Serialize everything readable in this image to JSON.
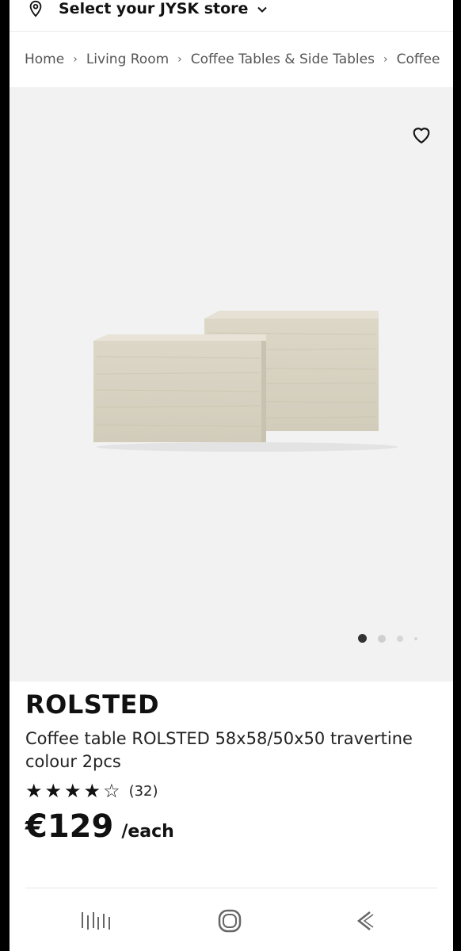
{
  "store_bar": {
    "label": "Select your JYSK store",
    "icons": {
      "location": "location-pin-icon",
      "dropdown": "chevron-down-icon"
    }
  },
  "breadcrumb": {
    "items": [
      "Home",
      "Living Room",
      "Coffee Tables & Side Tables",
      "Coffee"
    ],
    "separator": "›"
  },
  "gallery": {
    "favorite_icon": "heart-outline-icon",
    "image_alt": "Two travertine-colour nesting cube coffee tables",
    "current_slide": 1,
    "slide_count": 4
  },
  "product": {
    "title": "ROLSTED",
    "description": "Coffee table ROLSTED 58x58/50x50 travertine colour 2pcs",
    "rating": {
      "stars": 4,
      "max": 5,
      "count": "(32)"
    },
    "price": "€129",
    "unit": "/each"
  },
  "system_nav": {
    "recents": "recents-icon",
    "home": "home-icon",
    "back": "back-icon"
  },
  "colors": {
    "gallery_bg": "#f2f2f2",
    "text": "#111111",
    "travertine": "#d9d3c3"
  }
}
